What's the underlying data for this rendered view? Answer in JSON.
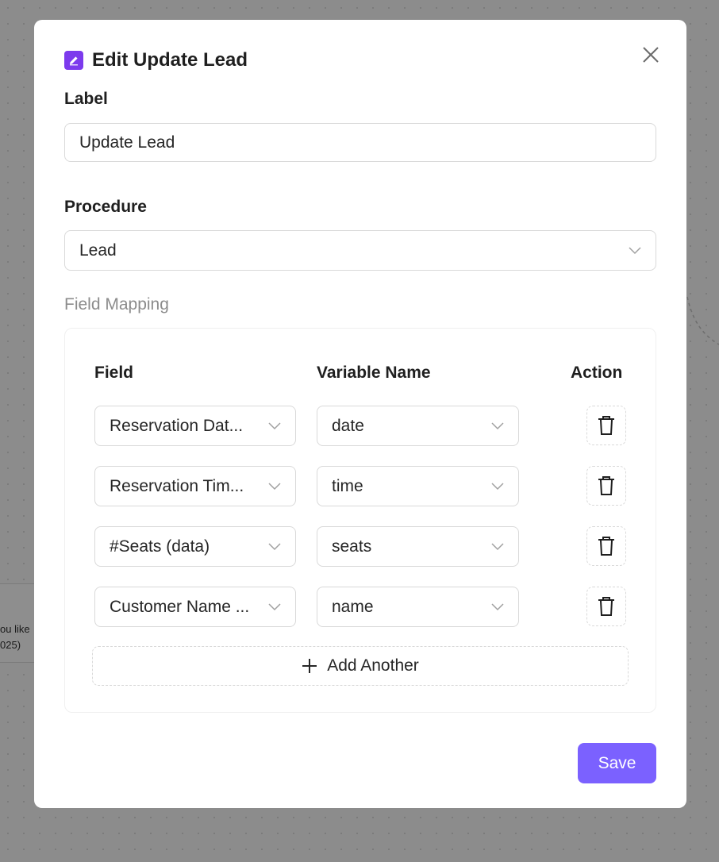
{
  "background": {
    "node_text_line1": "ou like",
    "node_text_line2": "025)"
  },
  "modal": {
    "title": "Edit Update Lead",
    "icon": "edit-icon",
    "close_icon": "close-icon"
  },
  "form": {
    "label_heading": "Label",
    "label_value": "Update Lead",
    "procedure_heading": "Procedure",
    "procedure_value": "Lead",
    "field_mapping_heading": "Field Mapping"
  },
  "mapping": {
    "columns": {
      "field": "Field",
      "variable": "Variable Name",
      "action": "Action"
    },
    "rows": [
      {
        "field": "Reservation Date (data)",
        "field_display": "Reservation Dat...",
        "variable": "date"
      },
      {
        "field": "Reservation Time (data)",
        "field_display": "Reservation Tim...",
        "variable": "time"
      },
      {
        "field": "#Seats (data)",
        "field_display": "#Seats (data)",
        "variable": "seats"
      },
      {
        "field": "Customer Name (data)",
        "field_display": "Customer Name ...",
        "variable": "name"
      }
    ],
    "add_label": "Add Another"
  },
  "footer": {
    "save_label": "Save"
  },
  "colors": {
    "accent": "#7b61ff",
    "icon_purple": "#7c3aed",
    "overlay": "#8c8c8c"
  }
}
